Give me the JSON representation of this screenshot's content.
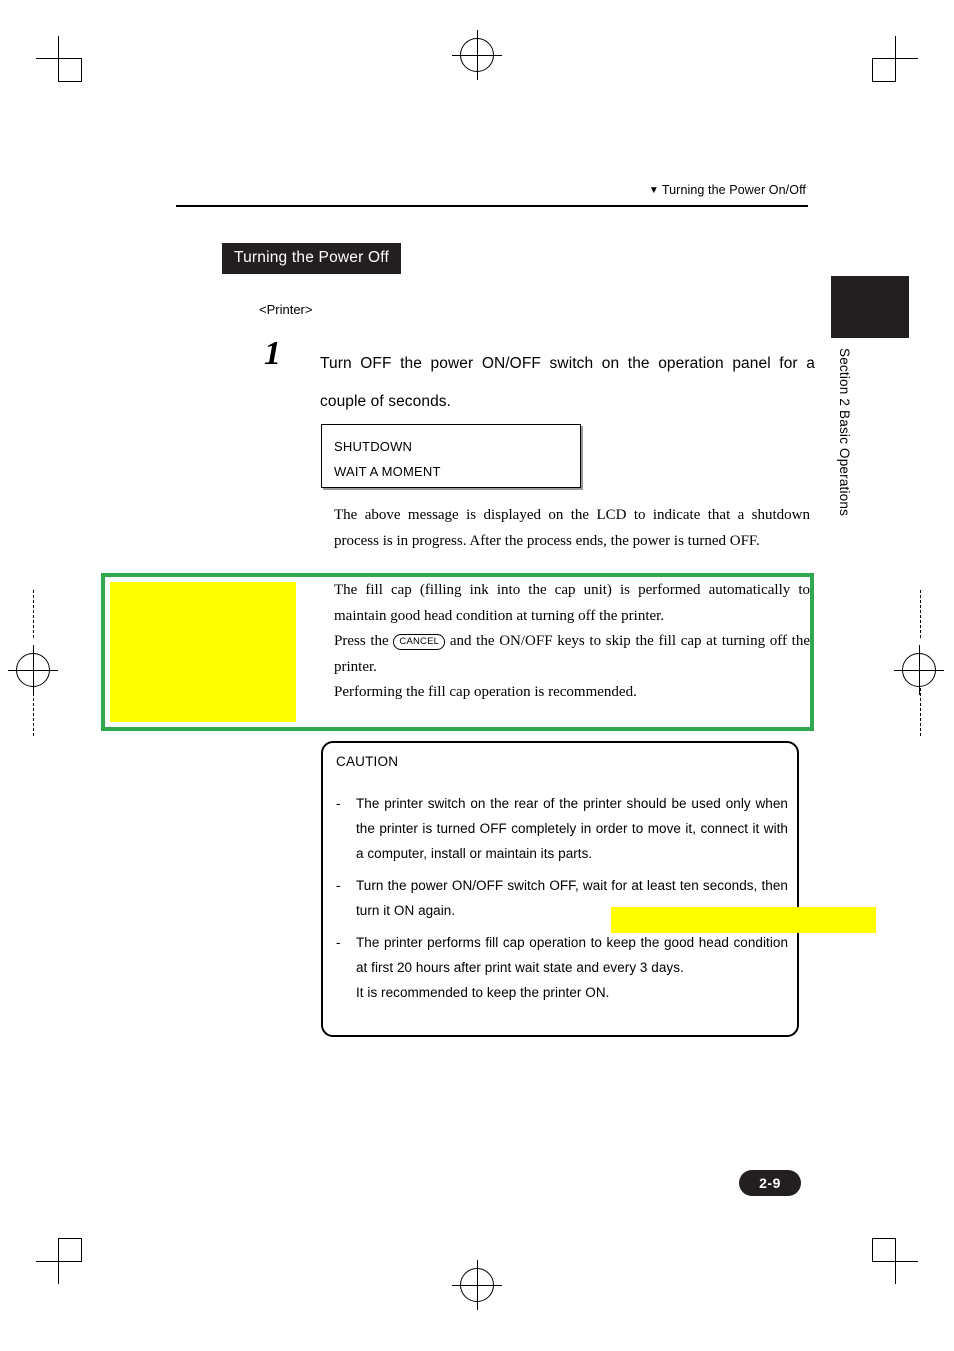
{
  "header": {
    "triangle_icon": "▼",
    "running_head": "Turning the Power On/Off"
  },
  "side_tab": {
    "section_label": "Section 2  Basic Operations"
  },
  "heading": {
    "title": "Turning the Power Off"
  },
  "subheading": {
    "text": "<Printer>"
  },
  "step": {
    "number": "1",
    "text": "Turn OFF the power ON/OFF switch on the operation panel for a couple of seconds."
  },
  "lcd": {
    "line1": "SHUTDOWN",
    "line2": "WAIT A MOMENT"
  },
  "paragraphs": {
    "after_lcd": "The above message is displayed on the LCD to indicate that a shutdown process is in progress.  After the process ends, the power is turned OFF.",
    "note_line1": "The fill cap (filling ink into the cap unit) is performed automatically to maintain good head condition at turning off the printer.",
    "note_line2_before_key": "Press the ",
    "note_key_label": "CANCEL",
    "note_line2_after_key": " and the ON/OFF keys to skip the fill cap at turning off the printer.",
    "note_line3": "Performing the fill cap operation is recommended."
  },
  "caution": {
    "title": "CAUTION",
    "bullet_marker": "-",
    "items": [
      {
        "text": "The printer switch on the rear of the printer should be used only when the printer is turned OFF completely in order to move it, connect it with a computer, install or maintain its parts.",
        "extra": ""
      },
      {
        "text": "Turn the power ON/OFF switch OFF, wait for at least ten seconds, then turn it ON again.",
        "extra": ""
      },
      {
        "text": "The printer performs fill cap operation to keep the good head condition at first 20 hours after print wait state and every 3 days.",
        "extra": "It is recommended to keep the printer ON."
      }
    ]
  },
  "page": {
    "number": "2-9"
  },
  "colors": {
    "highlight_yellow": "#ffff00",
    "annotation_green": "#2fa84f",
    "dark": "#231f20"
  }
}
